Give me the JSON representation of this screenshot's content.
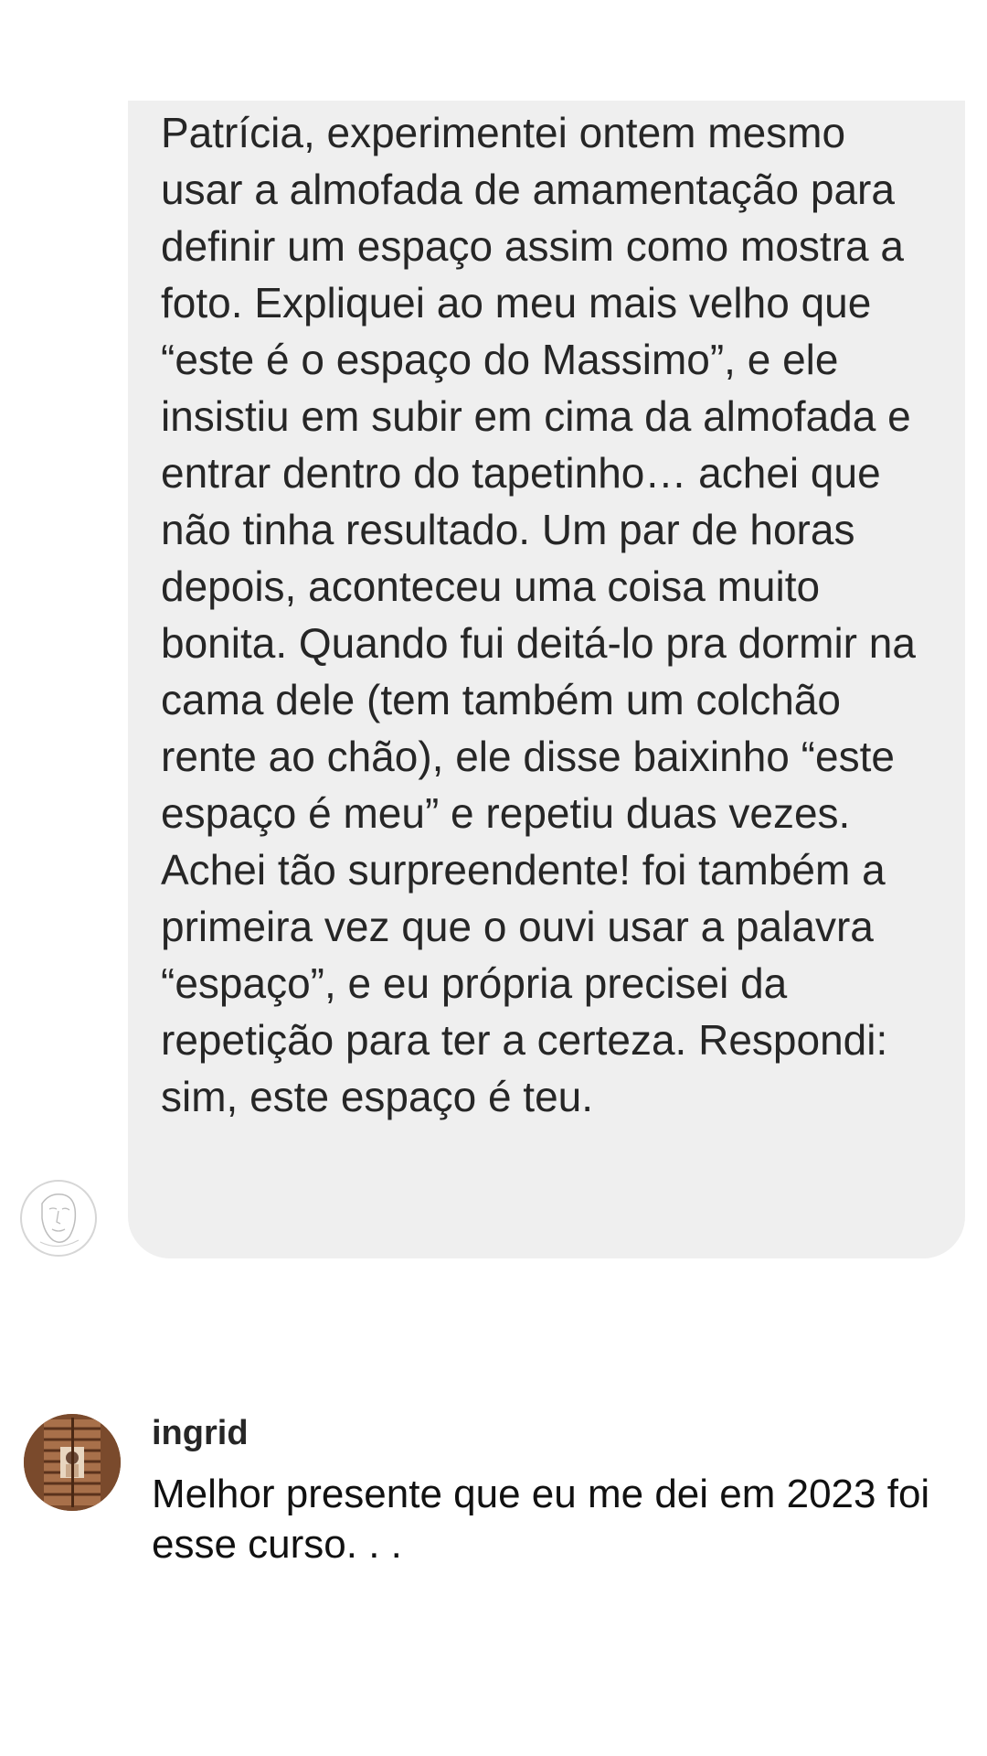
{
  "message": {
    "text": "Patrícia, experimentei ontem mesmo usar a almofada de amamentação para definir um espaço assim como mostra a foto. Expliquei ao meu mais velho que “este é o espaço do Massimo”, e ele insistiu em subir em cima da almofada e entrar dentro do tapetinho… achei que não tinha resultado. Um par de horas depois, aconteceu uma coisa muito bonita. Quando fui deitá-lo pra dormir na cama dele (tem também um colchão rente ao chão), ele disse baixinho “este espaço é meu” e repetiu duas vezes. Achei tão surpreendente! foi também a primeira vez que o ouvi usar a palavra “espaço”, e eu própria precisei da repetição para ter a certeza. Respondi: sim, este espaço é teu.",
    "bubble_color": "#efefef"
  },
  "sender_avatar": {
    "icon": "sketch-face-icon"
  },
  "comment": {
    "username": "ingrid",
    "text": "Melhor presente que eu me dei em 2023 foi esse curso. . .",
    "avatar_icon": "window-shutter-photo-icon"
  }
}
